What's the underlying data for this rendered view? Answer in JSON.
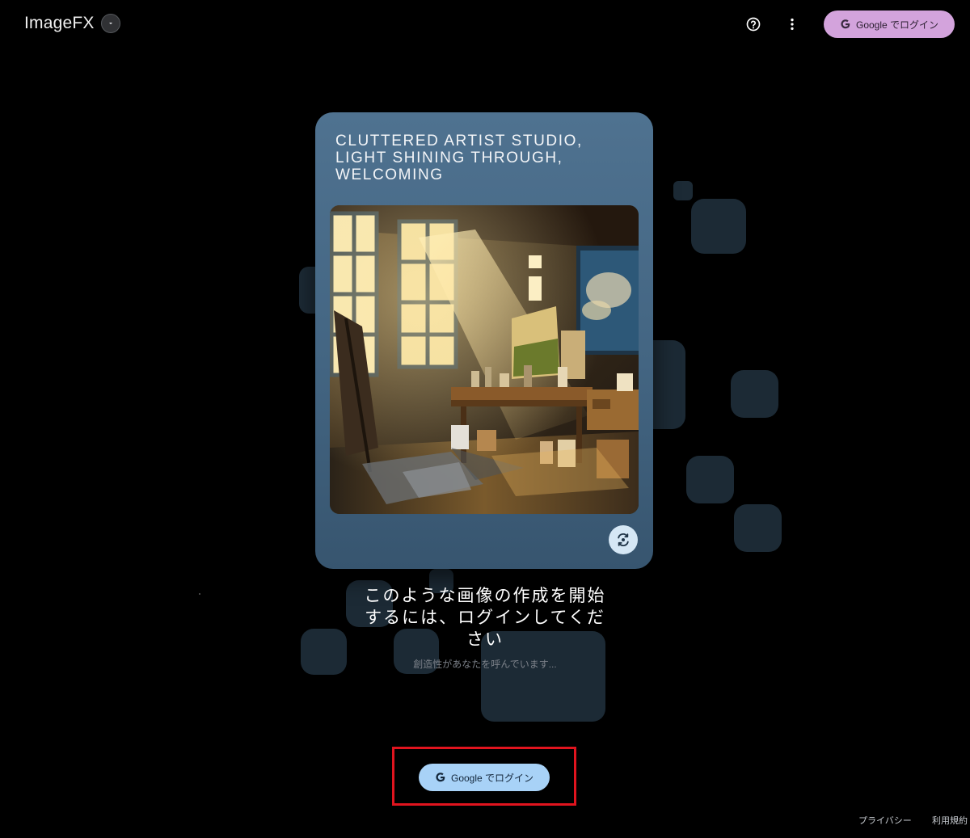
{
  "header": {
    "app_title": "ImageFX",
    "login_label": "Google でログイン"
  },
  "card": {
    "caption": "CLUTTERED ARTIST STUDIO, LIGHT SHINING THROUGH, WELCOMING"
  },
  "main": {
    "heading": "このような画像の作成を開始するには、ログインしてください",
    "subtext": "創造性があなたを呼んでいます...",
    "login_label": "Google でログイン"
  },
  "footer": {
    "privacy": "プライバシー",
    "terms": "利用規約"
  },
  "icons": {
    "dropdown": "chevron-down-icon",
    "help": "help-circle-icon",
    "more": "more-vert-icon",
    "google": "google-g-icon",
    "refresh": "refresh-icon"
  },
  "colors": {
    "background": "#000000",
    "top_login_button": "#d3a3dc",
    "main_login_button": "#a8d2f7",
    "card": "#4f7290",
    "tile": "#1c2a35",
    "highlight": "#e0141e"
  }
}
